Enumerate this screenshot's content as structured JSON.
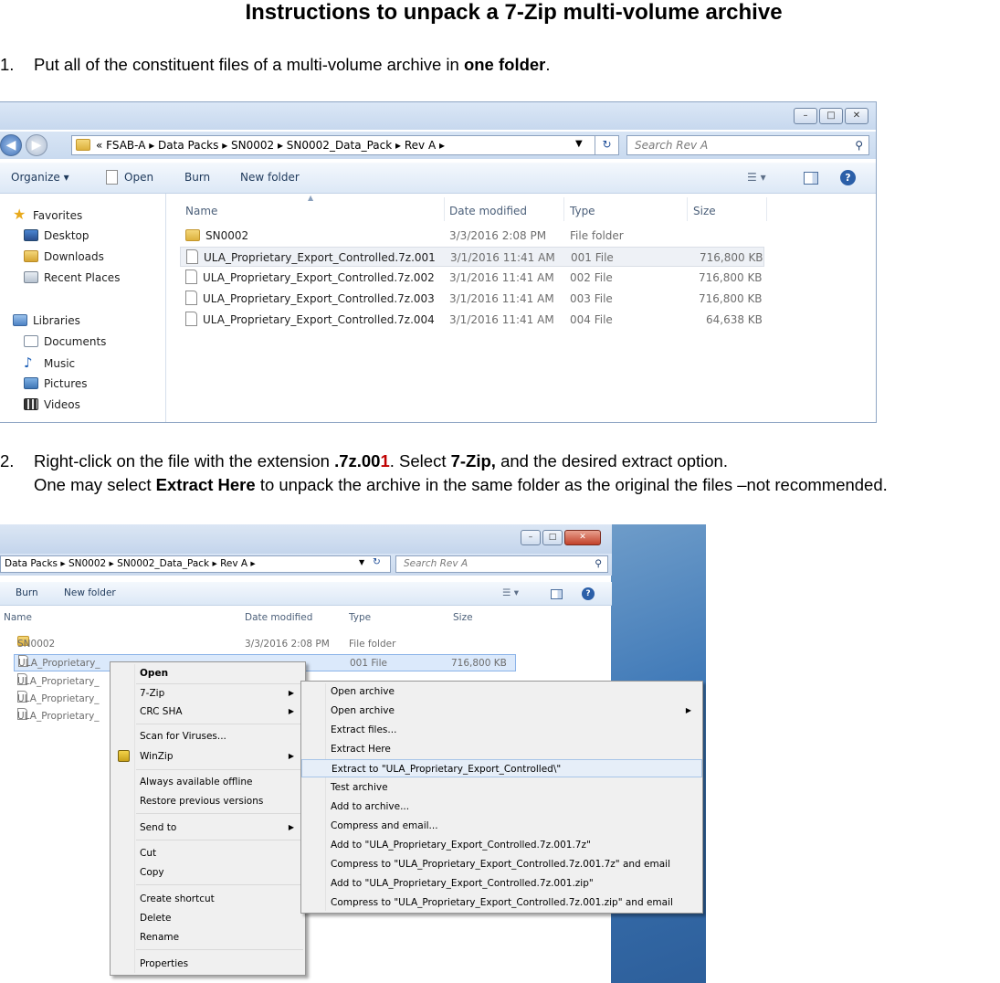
{
  "document": {
    "title": "Instructions to unpack a 7-Zip multi-volume archive",
    "step1": {
      "num": "1.",
      "text_before": "Put all of the constituent files of a multi-volume archive in ",
      "bold": "one folder",
      "text_after": "."
    },
    "step2": {
      "num": "2.",
      "line1_a": "Right-click on the file with the extension ",
      "line1_ext_black": ".7z.00",
      "line1_ext_red": "1",
      "line1_b": ". Select ",
      "line1_bold2": "7-Zip,",
      "line1_c": " and the desired extract option.",
      "line2_a": "One may select ",
      "line2_bold": "Extract Here",
      "line2_b": " to unpack the archive in the same folder as the original the files –not recommended."
    },
    "accent_red": "#c00000"
  },
  "explorer1": {
    "window_buttons": [
      "–",
      "□",
      "✕"
    ],
    "breadcrumb": "«  FSAB-A  ▸  Data Packs  ▸  SN0002  ▸  SN0002_Data_Pack  ▸  Rev A  ▸",
    "search_placeholder": "Search Rev A",
    "toolbar": {
      "organize": "Organize ▾",
      "open": "Open",
      "burn": "Burn",
      "new_folder": "New folder"
    },
    "nav": {
      "favorites": "Favorites",
      "desktop": "Desktop",
      "downloads": "Downloads",
      "recent": "Recent Places",
      "libraries": "Libraries",
      "documents": "Documents",
      "music": "Music",
      "pictures": "Pictures",
      "videos": "Videos"
    },
    "columns": {
      "name": "Name",
      "date": "Date modified",
      "type": "Type",
      "size": "Size"
    },
    "rows": [
      {
        "name": "SN0002",
        "date": "3/3/2016 2:08 PM",
        "type": "File folder",
        "size": ""
      },
      {
        "name": "ULA_Proprietary_Export_Controlled.7z.001",
        "date": "3/1/2016 11:41 AM",
        "type": "001 File",
        "size": "716,800 KB"
      },
      {
        "name": "ULA_Proprietary_Export_Controlled.7z.002",
        "date": "3/1/2016 11:41 AM",
        "type": "002 File",
        "size": "716,800 KB"
      },
      {
        "name": "ULA_Proprietary_Export_Controlled.7z.003",
        "date": "3/1/2016 11:41 AM",
        "type": "003 File",
        "size": "716,800 KB"
      },
      {
        "name": "ULA_Proprietary_Export_Controlled.7z.004",
        "date": "3/1/2016 11:41 AM",
        "type": "004 File",
        "size": "64,638 KB"
      }
    ]
  },
  "explorer2": {
    "breadcrumb": "Data Packs  ▸  SN0002  ▸  SN0002_Data_Pack  ▸  Rev A  ▸",
    "search_placeholder": "Search Rev A",
    "toolbar": {
      "burn": "Burn",
      "new_folder": "New folder"
    },
    "columns": {
      "name": "Name",
      "date": "Date modified",
      "type": "Type",
      "size": "Size"
    },
    "rows": [
      {
        "name": "SN0002",
        "date": "3/3/2016 2:08 PM",
        "type": "File folder",
        "size": ""
      },
      {
        "name": "ULA_Proprietary_",
        "date": "",
        "type": "001 File",
        "size": "716,800 KB"
      },
      {
        "name": "ULA_Proprietary_"
      },
      {
        "name": "ULA_Proprietary_"
      },
      {
        "name": "ULA_Proprietary_"
      }
    ],
    "context_menu": {
      "open": "Open",
      "seven_zip": "7-Zip",
      "crc_sha": "CRC SHA",
      "scan": "Scan for Viruses...",
      "winzip": "WinZip",
      "offline": "Always available offline",
      "restore": "Restore previous versions",
      "send_to": "Send to",
      "cut": "Cut",
      "copy": "Copy",
      "create_shortcut": "Create shortcut",
      "delete": "Delete",
      "rename": "Rename",
      "properties": "Properties"
    },
    "submenu": {
      "open_archive": "Open archive",
      "open_archive2": "Open archive",
      "extract_files": "Extract files...",
      "extract_here": "Extract Here",
      "extract_to": "Extract to \"ULA_Proprietary_Export_Controlled\\\"",
      "test": "Test archive",
      "add": "Add to archive...",
      "compress_email": "Compress and email...",
      "add_7z": "Add to \"ULA_Proprietary_Export_Controlled.7z.001.7z\"",
      "compress_7z_email": "Compress to \"ULA_Proprietary_Export_Controlled.7z.001.7z\" and email",
      "add_zip": "Add to \"ULA_Proprietary_Export_Controlled.7z.001.zip\"",
      "compress_zip_email": "Compress to \"ULA_Proprietary_Export_Controlled.7z.001.zip\" and email"
    }
  }
}
